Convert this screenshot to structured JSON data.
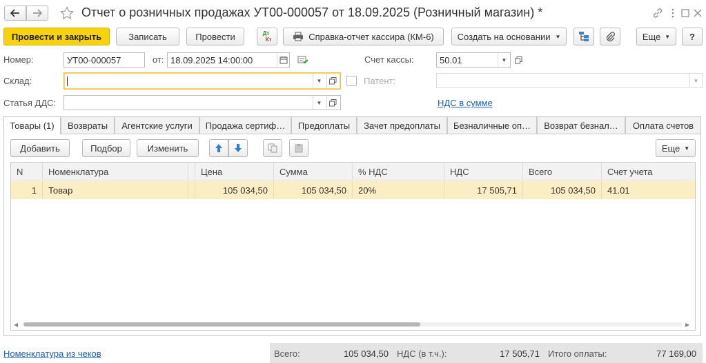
{
  "window": {
    "title": "Отчет о розничных продажах УТ00-000057 от 18.09.2025 (Розничный магазин) *",
    "link_icon": "link-icon",
    "more_icon": "more-vertical-icon",
    "maximize_icon": "maximize-icon",
    "close_icon": "close-icon"
  },
  "toolbar": {
    "post_close": "Провести и закрыть",
    "save": "Записать",
    "post": "Провести",
    "dtkt_top": "Дт",
    "dtkt_bottom": "Кт",
    "cashier_report": "Справка-отчет кассира (КМ-6)",
    "create_based": "Создать на основании",
    "more": "Еще",
    "help": "?"
  },
  "form": {
    "number_label": "Номер:",
    "number_value": "УТ00-000057",
    "from_label": "от:",
    "date_value": "18.09.2025 14:00:00",
    "cash_account_label": "Счет кассы:",
    "cash_account_value": "50.01",
    "warehouse_label": "Склад:",
    "warehouse_value": "",
    "patent_label": "Патент:",
    "patent_value": "",
    "dds_label": "Статья ДДС:",
    "dds_value": "",
    "vat_link": "НДС в сумме"
  },
  "tabs": [
    {
      "label": "Товары (1)"
    },
    {
      "label": "Возвраты"
    },
    {
      "label": "Агентские услуги"
    },
    {
      "label": "Продажа сертиф…"
    },
    {
      "label": "Предоплаты"
    },
    {
      "label": "Зачет предоплаты"
    },
    {
      "label": "Безналичные оп…"
    },
    {
      "label": "Возврат безнал…"
    },
    {
      "label": "Оплата счетов"
    }
  ],
  "table_toolbar": {
    "add": "Добавить",
    "select": "Подбор",
    "change": "Изменить",
    "more": "Еще"
  },
  "table": {
    "columns": [
      "N",
      "Номенклатура",
      "Цена",
      "Сумма",
      "% НДС",
      "НДС",
      "Всего",
      "Счет учета"
    ],
    "rows": [
      {
        "n": "1",
        "item": "Товар",
        "price": "105 034,50",
        "sum": "105 034,50",
        "vat_rate": "20%",
        "vat": "17 505,71",
        "total": "105 034,50",
        "account": "41.01"
      }
    ]
  },
  "footer": {
    "link": "Номенклатура из чеков",
    "total_label": "Всего:",
    "total_value": "105 034,50",
    "vat_label": "НДС (в т.ч.):",
    "vat_value": "17 505,71",
    "paid_label": "Итого оплаты:",
    "paid_value": "77 169,00"
  },
  "colors": {
    "accent_yellow": "#f7d20e",
    "row_highlight": "#fbeec5",
    "link_blue": "#1c5fb4"
  }
}
